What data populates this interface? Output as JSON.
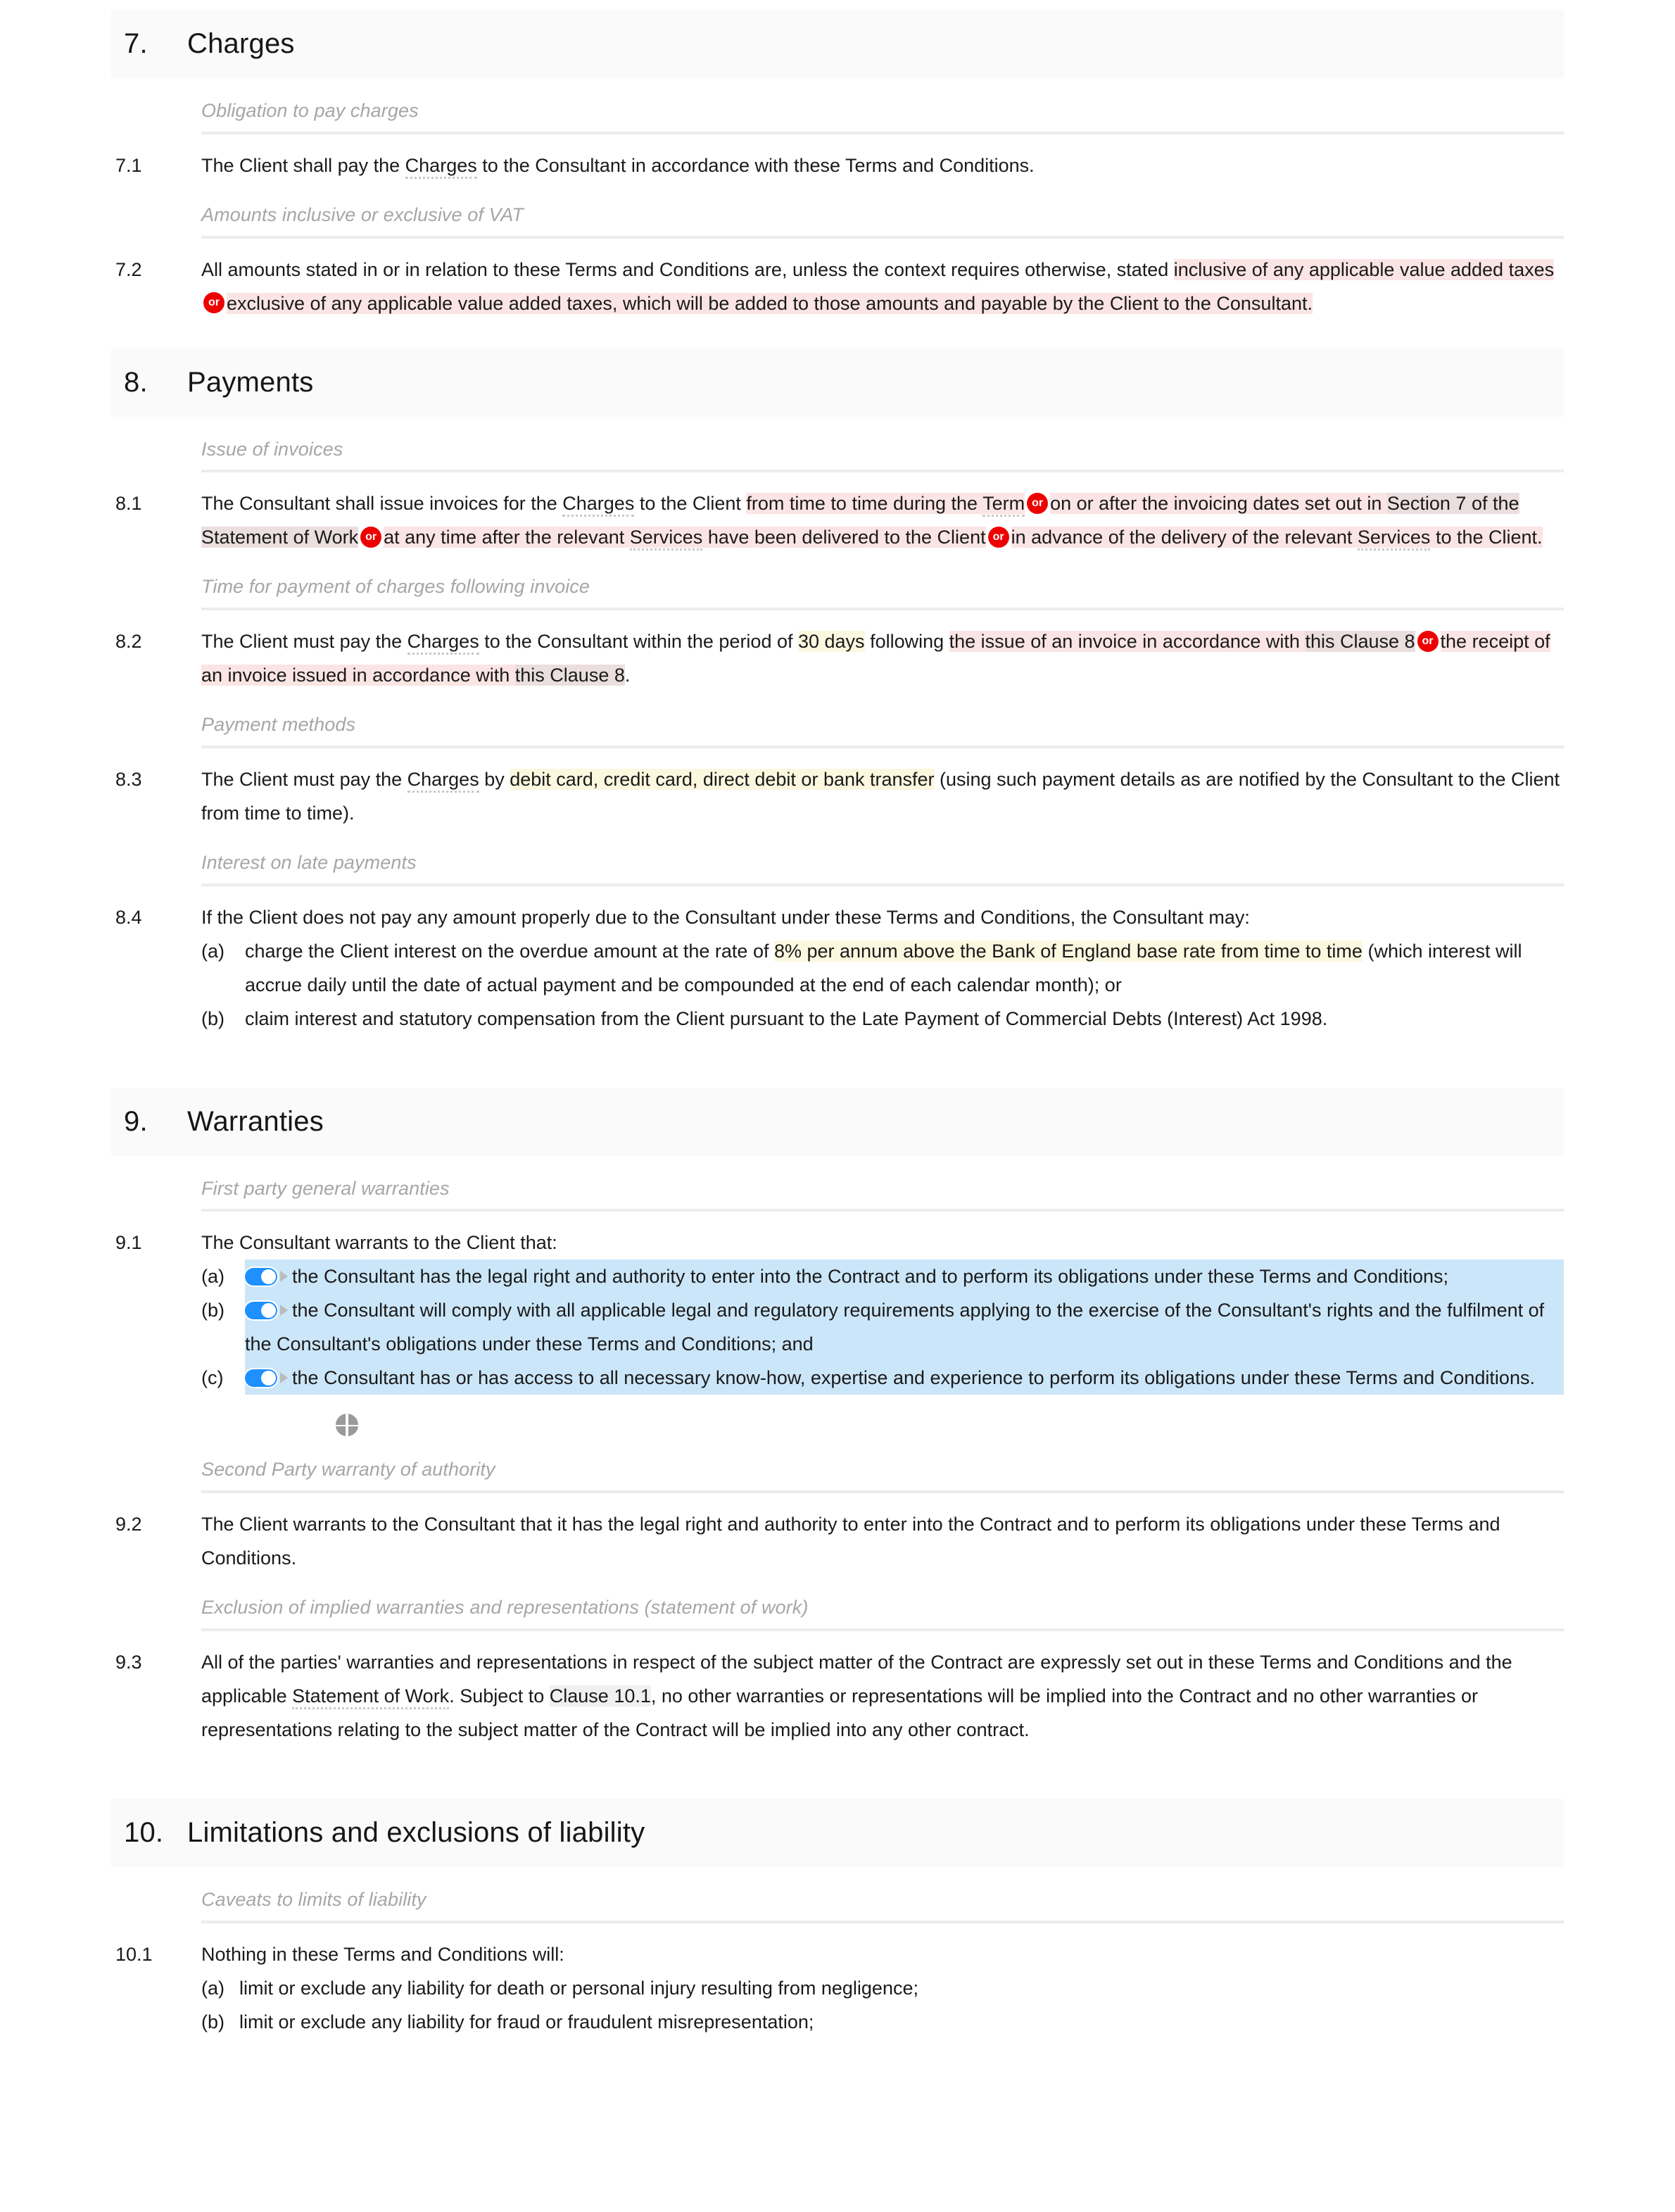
{
  "document": {
    "type": "legal-terms-and-conditions",
    "colors": {
      "or_badge": "#ee0000",
      "toggle_on": "#1e90ff",
      "highlight_pink": "#fbe4e4",
      "highlight_yellow": "#fcf8e0",
      "highlight_blue": "#cce6f9",
      "highlight_grey": "#f0f0f0",
      "section_band": "#fafafa",
      "caption_text": "#a6a6a6"
    },
    "badges": {
      "or_label": "or"
    }
  },
  "sections": [
    {
      "number": "7.",
      "title": "Charges",
      "captions": {
        "c1": "Obligation to pay charges",
        "c2": "Amounts inclusive or exclusive of VAT"
      },
      "clauses": {
        "n71": "7.1",
        "n72": "7.2"
      },
      "c71": {
        "t1": "The Client shall pay the ",
        "t2": "Charges",
        "t3": " to the Consultant in accordance with these Terms and Conditions."
      },
      "c72": {
        "t1": "All amounts stated in or in relation to these Terms and Conditions are, unless the context requires otherwise, stated ",
        "t2": "inclusive of any applicable value added taxes",
        "t3": "exclusive of any applicable value added taxes, which will be added to those amounts and payable by the Client to the Consultant."
      }
    },
    {
      "number": "8.",
      "title": "Payments",
      "captions": {
        "c1": "Issue of invoices",
        "c2": "Time for payment of charges following invoice",
        "c3": "Payment methods",
        "c4": "Interest on late payments"
      },
      "clauses": {
        "n81": "8.1",
        "n82": "8.2",
        "n83": "8.3",
        "n84": "8.4"
      },
      "c81": {
        "t1": "The Consultant shall issue invoices for the ",
        "t2": "Charges",
        "t3": " to the Client ",
        "t4": "from time to time during the ",
        "t5": "Term",
        "t6": "on or after the invoicing dates set out in ",
        "t7": "Section 7 of the Statement of Work",
        "t8": "at any time after the relevant ",
        "t9": "Services",
        "t10": " have been delivered to the Client",
        "t11": "in advance of the delivery of the relevant ",
        "t12": "Services",
        "t13": " to the Client."
      },
      "c82": {
        "t1": "The Client must pay the ",
        "t2": "Charges",
        "t3": " to the Consultant within the period of ",
        "t4": "30 days",
        "t5": " following ",
        "t6": "the issue of an invoice in accordance with ",
        "t7": "this Clause 8",
        "t8": "the receipt of an invoice issued in accordance with ",
        "t9": "this Clause 8",
        "t10": "."
      },
      "c83": {
        "t1": "The Client must pay the ",
        "t2": "Charges",
        "t3": " by ",
        "t4": "debit card, credit card, direct debit or bank transfer",
        "t5": " (using such payment details as are notified by the Consultant to the Client from time to time)."
      },
      "c84": {
        "intro": "If the Client does not pay any amount properly due to the Consultant under these Terms and Conditions, the Consultant may:",
        "items": [
          {
            "label": "(a)",
            "t1": "charge the Client interest on the overdue amount at the rate of ",
            "t2": "8% per annum above the Bank of England base rate from time to time",
            "t3": " (which interest will accrue daily until the date of actual payment and be compounded at the end of each calendar month); or"
          },
          {
            "label": "(b)",
            "t1": "claim interest and statutory compensation from the Client pursuant to the Late Payment of Commercial Debts (Interest) Act 1998.",
            "t2": "",
            "t3": ""
          }
        ]
      }
    },
    {
      "number": "9.",
      "title": "Warranties",
      "captions": {
        "c1": "First party general warranties",
        "c2": "Second Party warranty of authority",
        "c3": "Exclusion of implied warranties and representations (statement of work)"
      },
      "clauses": {
        "n91": "9.1",
        "n92": "9.2",
        "n93": "9.3"
      },
      "c91": {
        "intro": "The Consultant warrants to the Client that:",
        "items": [
          {
            "label": "(a)",
            "text": "the Consultant has the legal right and authority to enter into the Contract and to perform its obligations under these Terms and Conditions;",
            "toggle": "on"
          },
          {
            "label": "(b)",
            "text": "the Consultant will comply with all applicable legal and regulatory requirements applying to the exercise of the Consultant's rights and the fulfilment of the Consultant's obligations under these Terms and Conditions; and",
            "toggle": "on"
          },
          {
            "label": "(c)",
            "text": "the Consultant has or has access to all necessary know-how, expertise and experience to perform its obligations under these Terms and Conditions.",
            "toggle": "on"
          }
        ]
      },
      "c92": {
        "t1": "The Client warrants to the Consultant that it has the legal right and authority to enter into the Contract and to perform its obligations under these Terms and Conditions."
      },
      "c93": {
        "t1": "All of the parties' warranties and representations in respect of the subject matter of the Contract are expressly set out in these Terms and Conditions and the applicable ",
        "t2": "Statement of Work",
        "t3": ". Subject to ",
        "t4": "Clause 10.1",
        "t5": ", no other warranties or representations will be implied into the Contract and no other warranties or representations relating to the subject matter of the Contract will be implied into any other contract."
      }
    },
    {
      "number": "10.",
      "title": "Limitations and exclusions of liability",
      "captions": {
        "c1": "Caveats to limits of liability"
      },
      "clauses": {
        "n101": "10.1"
      },
      "c101": {
        "intro": "Nothing in these Terms and Conditions will:",
        "items": [
          {
            "label": "(a)",
            "text": "limit or exclude any liability for death or personal injury resulting from negligence;"
          },
          {
            "label": "(b)",
            "text": "limit or exclude any liability for fraud or fraudulent misrepresentation;"
          }
        ]
      }
    }
  ]
}
